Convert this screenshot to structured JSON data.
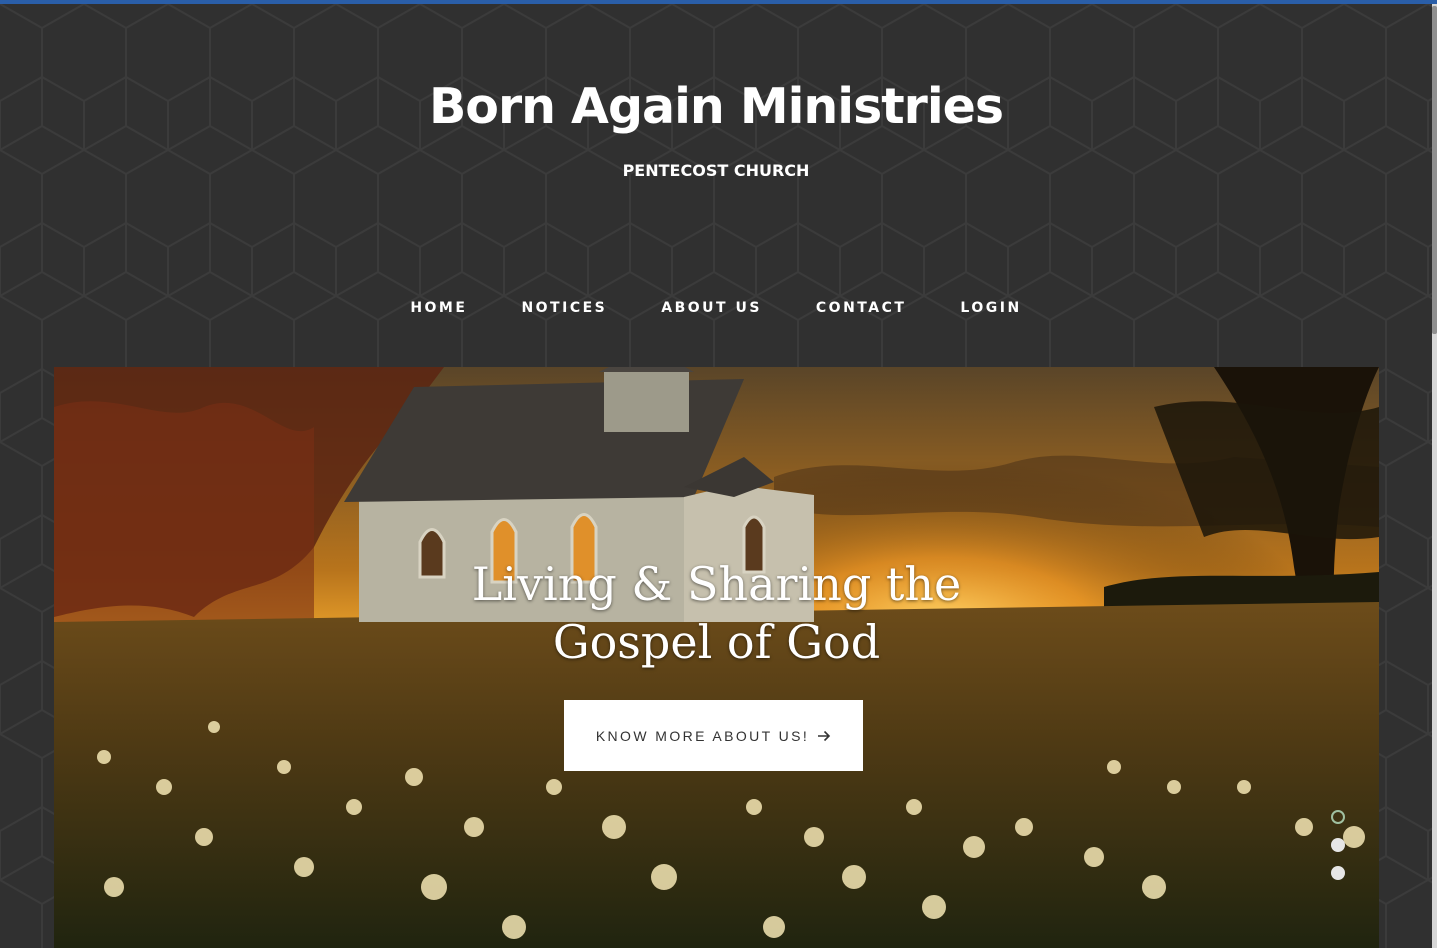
{
  "header": {
    "title": "Born Again Ministries",
    "tagline": "PENTECOST CHURCH"
  },
  "nav": {
    "items": [
      "HOME",
      "NOTICES",
      "ABOUT US",
      "CONTACT",
      "LOGIN"
    ]
  },
  "hero": {
    "headline_line1": "Living & Sharing the",
    "headline_line2": "Gospel of God",
    "cta_label": "KNOW MORE ABOUT US!",
    "cta_icon": "arrow-right-icon",
    "slides_total": 3,
    "active_slide": 1
  },
  "colors": {
    "background": "#303030",
    "top_accent": "#2a5ea8",
    "text": "#ffffff",
    "button_bg": "#ffffff",
    "button_text": "#333333"
  }
}
